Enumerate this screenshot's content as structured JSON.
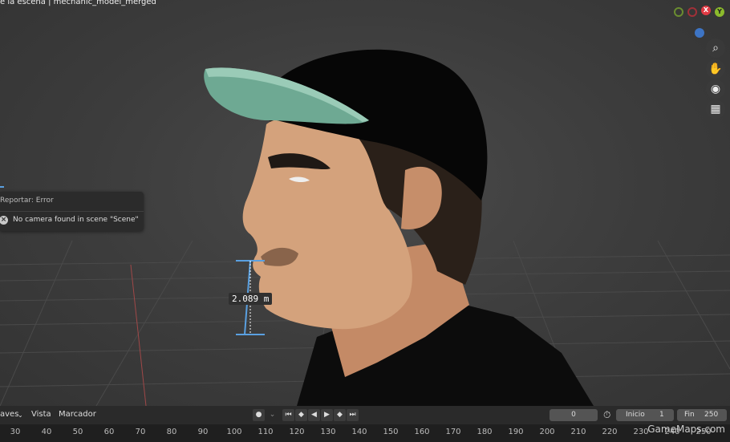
{
  "viewport": {
    "title": "e la escena | mechanic_model_merged",
    "measure": "2.089 m"
  },
  "report": {
    "header": "Reportar: Error",
    "message": "No camera found in scene \"Scene\""
  },
  "gizmo": {
    "x_label": "X",
    "y_label": "Y",
    "colors": {
      "x": "#e03a44",
      "y": "#8cbb2c",
      "z": "#3d74c4"
    }
  },
  "nav_icons": [
    "zoom-icon",
    "hand-pan-icon",
    "camera-icon",
    "grid-ortho-icon"
  ],
  "timeline": {
    "menu": {
      "keys": "aves",
      "view": "Vista",
      "marker": "Marcador"
    },
    "current_frame": "0",
    "start_label": "Inicio",
    "start_value": "1",
    "end_label": "Fin",
    "end_value": "250",
    "ticks": [
      "30",
      "40",
      "50",
      "60",
      "70",
      "80",
      "90",
      "100",
      "110",
      "120",
      "130",
      "140",
      "150",
      "160",
      "170",
      "180",
      "190",
      "200",
      "210",
      "220",
      "230",
      "240",
      "250"
    ]
  },
  "watermark": "GameMaps.com"
}
